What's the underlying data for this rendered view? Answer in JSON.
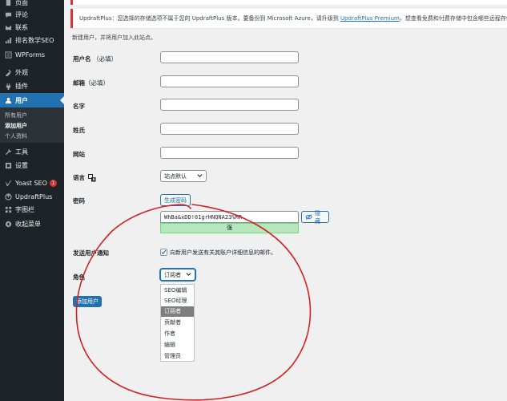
{
  "sidebar": {
    "items": [
      {
        "label": "页面",
        "icon": "page-icon"
      },
      {
        "label": "评论",
        "icon": "comment-icon"
      },
      {
        "label": "联系",
        "icon": "mail-icon"
      },
      {
        "label": "排名数学SEO",
        "icon": "rankmath-icon"
      },
      {
        "label": "WPForms",
        "icon": "forms-icon"
      },
      {
        "label": "外观",
        "icon": "appearance-icon"
      },
      {
        "label": "插件",
        "icon": "plugin-icon"
      },
      {
        "label": "用户",
        "icon": "user-icon"
      },
      {
        "label": "工具",
        "icon": "tools-icon"
      },
      {
        "label": "设置",
        "icon": "settings-icon"
      },
      {
        "label": "Yoast SEO",
        "icon": "yoast-icon",
        "badge": "1"
      },
      {
        "label": "UpdraftPlus",
        "icon": "updraft-icon"
      },
      {
        "label": "字图栏",
        "icon": "widget-icon"
      },
      {
        "label": "收起菜单",
        "icon": "collapse-icon"
      }
    ],
    "submenu": [
      "所有用户",
      "添加用户",
      "个人资料"
    ]
  },
  "notice": {
    "text_before": "UpdraftPlus：您选择的存储选项不属于您的 UpdraftPlus 版本。要备份到 Microsoft Azure，请升级到 ",
    "link": "UpdraftPlus Premium",
    "text_after": "。想查看免费和付费存储中包含哪些远程存储位置，请参见这里："
  },
  "intro": "新建用户，并将用户加入此站点。",
  "form": {
    "username_label": "用户名",
    "username_req": "（必填）",
    "email_label": "邮箱",
    "email_req": "（必填）",
    "firstname_label": "名字",
    "lastname_label": "姓氏",
    "website_label": "网站",
    "language_label": "语言",
    "language_value": "站点默认",
    "password_label": "密码",
    "generate_password_label": "生成密码",
    "password_value": "WhBa&xDD!01grHNQNA23%MR",
    "hide_label": "隐藏",
    "strength_label": "强",
    "notify_label": "发送用户通知",
    "notify_text": "向新用户发送有关其账户详细信息的邮件。",
    "role_label": "角色",
    "role_value": "订阅者",
    "role_options": [
      "SEO编辑",
      "SEO经理",
      "订阅者",
      "贡献者",
      "作者",
      "编辑",
      "管理员"
    ],
    "add_user_label": "添加用户"
  },
  "colors": {
    "sidebar_bg": "#1d2327",
    "accent": "#2271b1",
    "notice_border": "#d63638",
    "annotation": "#d4201e"
  }
}
